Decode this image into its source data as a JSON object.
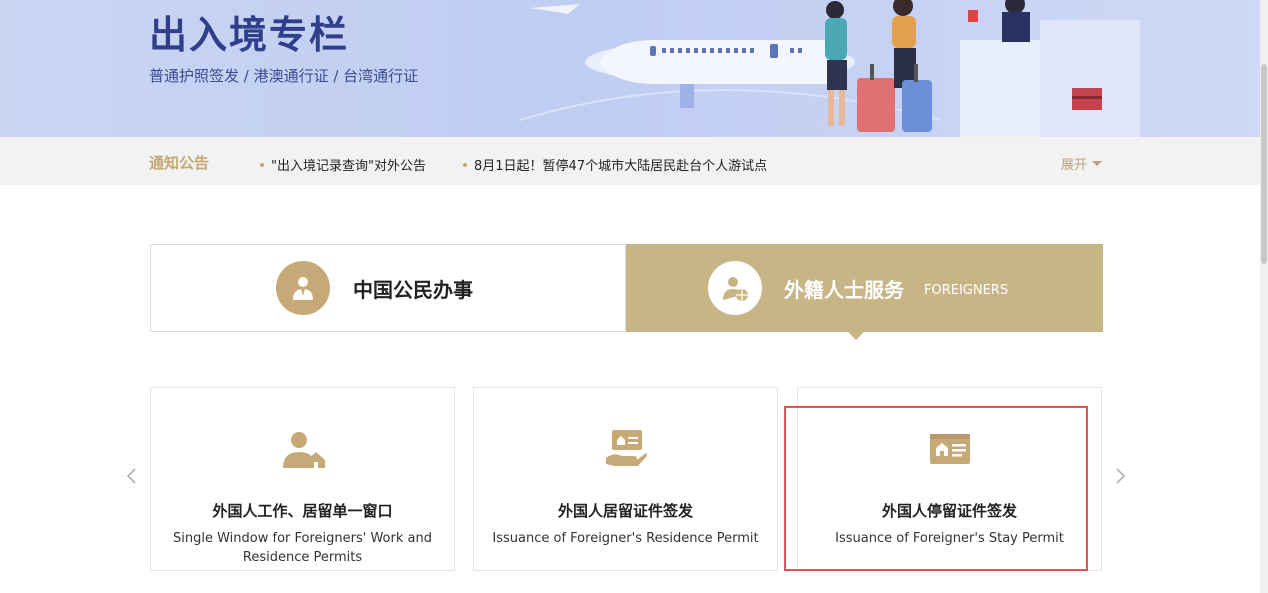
{
  "banner": {
    "title": "出入境专栏",
    "subtitle": "普通护照签发 / 港澳通行证 / 台湾通行证"
  },
  "notice": {
    "label": "通知公告",
    "items": [
      "\"出入境记录查询\"对外公告",
      "8月1日起！暂停47个城市大陆居民赴台个人游试点"
    ],
    "expand_label": "展开"
  },
  "tabs": {
    "citizen": {
      "label": "中国公民办事",
      "icon": "citizen-icon"
    },
    "foreigner": {
      "label": "外籍人士服务",
      "en": "FOREIGNERS",
      "icon": "foreigner-globe-icon",
      "active": true
    }
  },
  "cards": [
    {
      "title": "外国人工作、居留单一窗口",
      "en": "Single Window for Foreigners' Work and Residence Permits",
      "icon": "person-house-icon"
    },
    {
      "title": "外国人居留证件签发",
      "en": "Issuance of Foreigner's Residence Permit",
      "icon": "hand-card-icon"
    },
    {
      "title": "外国人停留证件签发",
      "en": "Issuance of Foreigner's Stay Permit",
      "icon": "id-card-icon"
    }
  ],
  "colors": {
    "accent_gold": "#c8b586",
    "icon_gold": "#c7a978",
    "banner_blue": "#2f3f8c",
    "highlight_red": "#e05555"
  }
}
